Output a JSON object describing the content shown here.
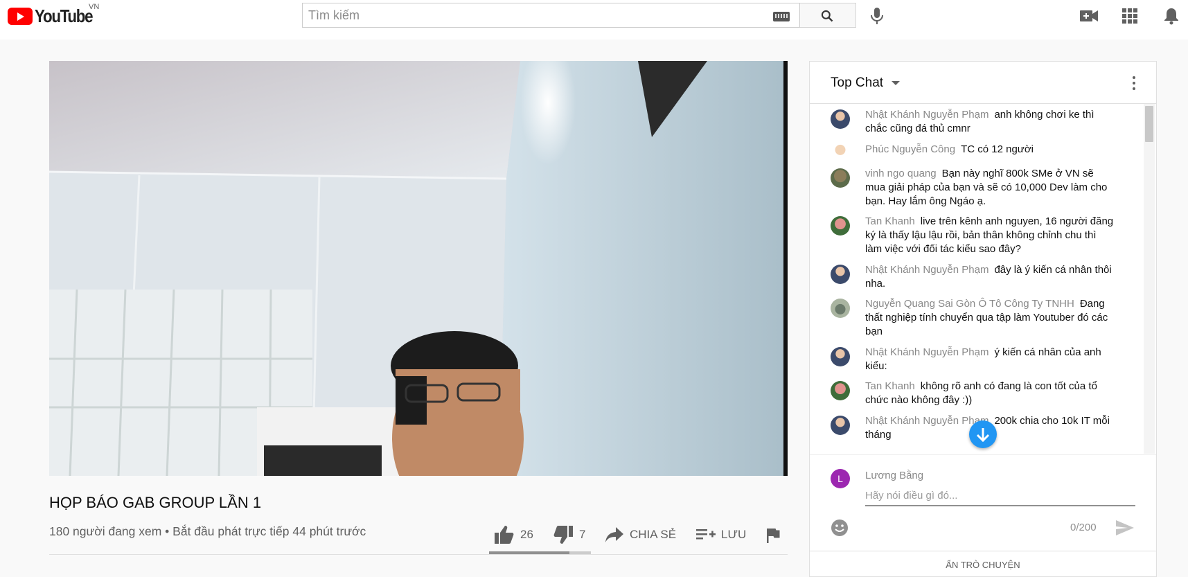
{
  "header": {
    "logo_text": "YouTube",
    "country": "VN",
    "search_placeholder": "Tìm kiếm"
  },
  "video": {
    "title": "HỌP BÁO GAB GROUP LẦN 1",
    "meta": "180 người đang xem • Bắt đầu phát trực tiếp 44 phút trước",
    "likes": "26",
    "dislikes": "7",
    "like_ratio": 0.79,
    "share_label": "CHIA SẺ",
    "save_label": "LƯU"
  },
  "chat": {
    "title": "Top Chat",
    "messages": [
      {
        "author": "Nhật Khánh Nguyễn Phạm",
        "text": "anh không chơi ke thì chắc cũng đá thủ cmnr"
      },
      {
        "author": "Phúc Nguyễn Công",
        "text": "TC có 12 người"
      },
      {
        "author": "vinh ngo quang",
        "text": "Bạn này nghĩ 800k SMe ở VN sẽ mua giải pháp của bạn và sẽ có 10,000 Dev làm cho bạn. Hay lắm ông Ngáo ạ."
      },
      {
        "author": "Tan Khanh",
        "text": "live trên kênh anh nguyen, 16 người đăng ký là thấy lậu lậu rồi, bản thân không chỉnh chu thì làm việc với đối tác kiểu sao đây?"
      },
      {
        "author": "Nhật Khánh Nguyễn Phạm",
        "text": "đây là ý kiến cá nhân thôi nha."
      },
      {
        "author": "Nguyễn Quang Sai Gòn Ô Tô Công Ty TNHH",
        "text": "Đang thất nghiệp tính chuyển qua tập làm Youtuber đó các bạn"
      },
      {
        "author": "Nhật Khánh Nguyễn Phạm",
        "text": "ý kiến cá nhân của anh kiểu:"
      },
      {
        "author": "Tan Khanh",
        "text": "không rõ anh có đang là con tốt của tổ chức nào không đây :))"
      },
      {
        "author": "Nhật Khánh Nguyễn Phạm",
        "text": "200k chia cho 10k IT mỗi tháng"
      }
    ],
    "user_initial": "L",
    "user_name": "Lương Bằng",
    "input_placeholder": "Hãy nói điều gì đó...",
    "counter": "0/200",
    "hide_label": "ẨN TRÒ CHUYỆN"
  }
}
